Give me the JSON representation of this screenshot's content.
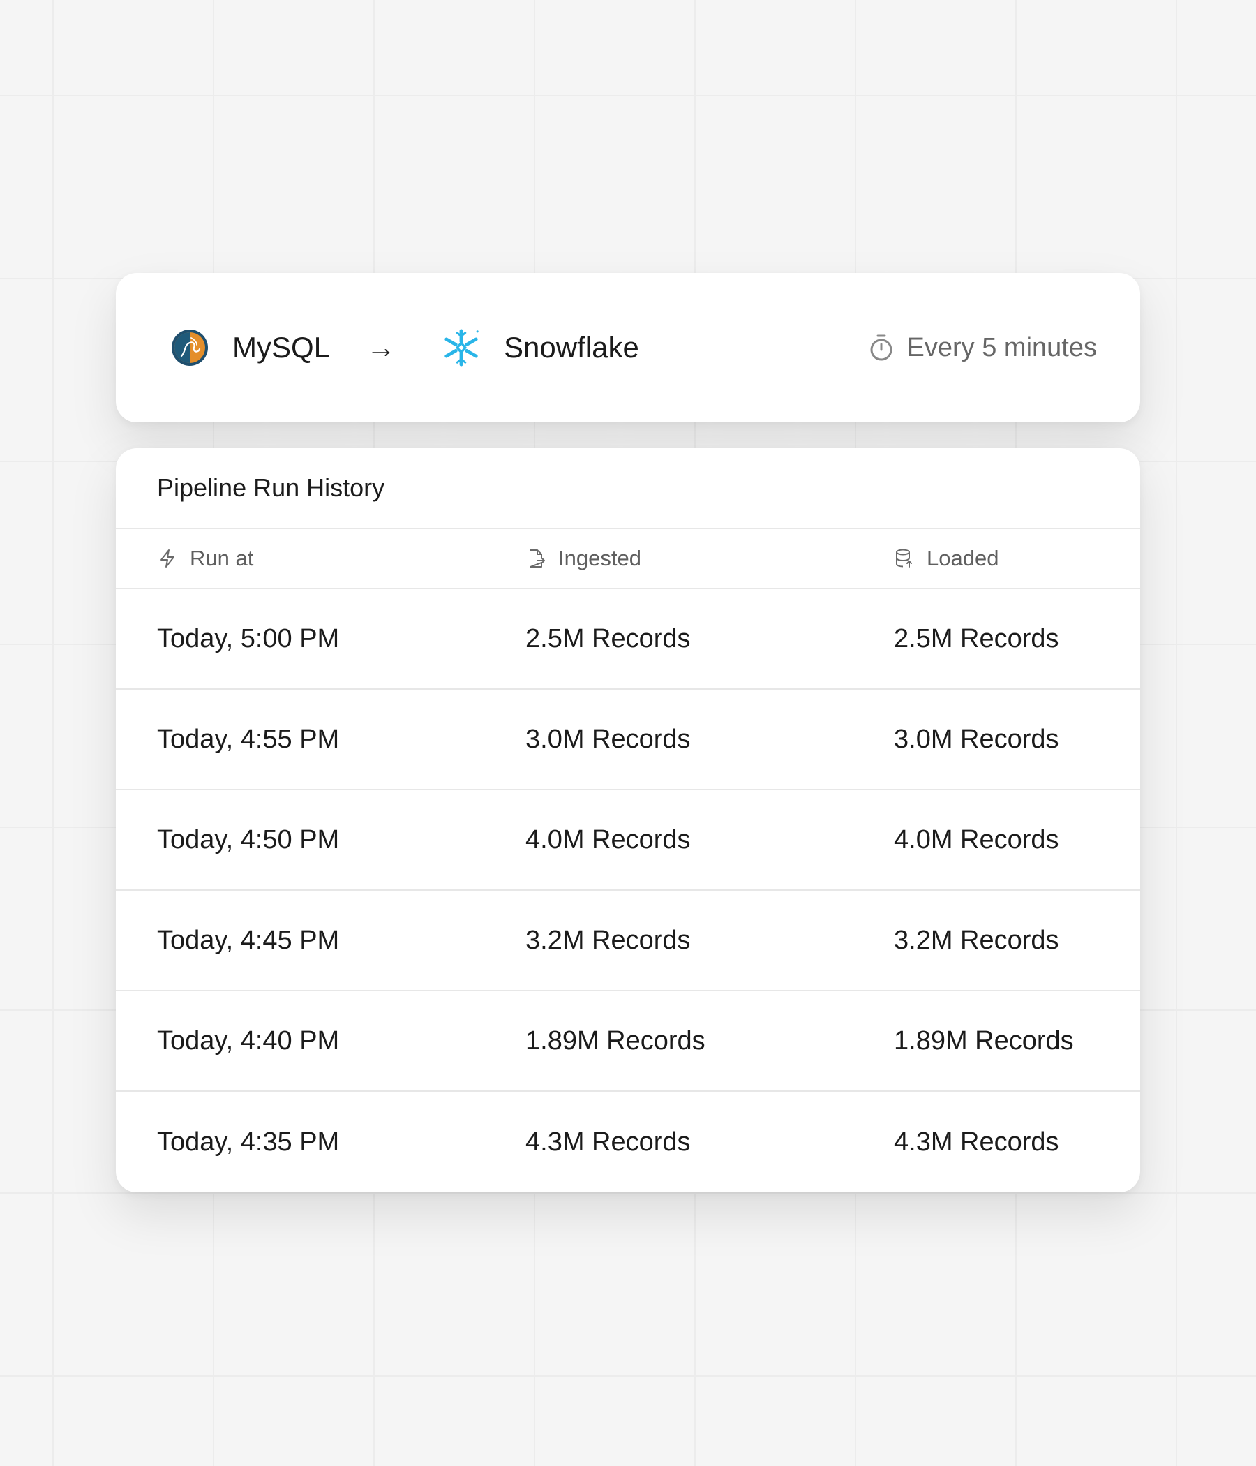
{
  "route": {
    "source": {
      "name": "MySQL",
      "icon": "mysql-logo-icon"
    },
    "arrow": "→",
    "destination": {
      "name": "Snowflake",
      "icon": "snowflake-logo-icon"
    },
    "schedule": {
      "icon": "stopwatch-icon",
      "label": "Every 5 minutes"
    }
  },
  "history": {
    "title": "Pipeline Run History",
    "columns": [
      {
        "label": "Run at",
        "icon": "lightning-icon"
      },
      {
        "label": "Ingested",
        "icon": "file-import-icon"
      },
      {
        "label": "Loaded",
        "icon": "database-upload-icon"
      }
    ],
    "rows": [
      {
        "run_at": "Today, 5:00 PM",
        "ingested": "2.5M Records",
        "loaded": "2.5M Records"
      },
      {
        "run_at": "Today, 4:55 PM",
        "ingested": "3.0M Records",
        "loaded": "3.0M Records"
      },
      {
        "run_at": "Today, 4:50 PM",
        "ingested": "4.0M Records",
        "loaded": "4.0M Records"
      },
      {
        "run_at": "Today, 4:45 PM",
        "ingested": "3.2M Records",
        "loaded": "3.2M Records"
      },
      {
        "run_at": "Today, 4:40 PM",
        "ingested": "1.89M Records",
        "loaded": "1.89M Records"
      },
      {
        "run_at": "Today, 4:35 PM",
        "ingested": "4.3M Records",
        "loaded": "4.3M Records"
      }
    ]
  },
  "colors": {
    "background": "#f5f5f5",
    "card": "#ffffff",
    "mysql_orange": "#e48e2a",
    "mysql_blue": "#1f5a7a",
    "snowflake_blue": "#29b5e8",
    "muted_text": "#666666"
  }
}
